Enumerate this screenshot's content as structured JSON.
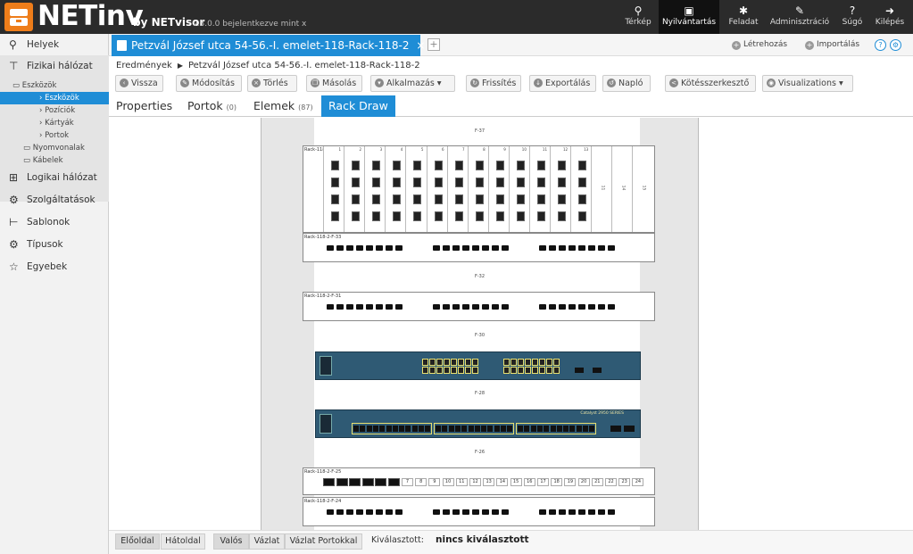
{
  "header": {
    "brand": "NETinv",
    "by": "by NETvisor",
    "version": "v.3.0.0 bejelentkezve mint x",
    "nav": [
      {
        "label": "Térkép",
        "icon": "map-pin-icon",
        "glyph": "⚲"
      },
      {
        "label": "Nyilvántartás",
        "icon": "inbox-icon",
        "glyph": "▣"
      },
      {
        "label": "Feladat",
        "icon": "gear-icon",
        "glyph": "✱"
      },
      {
        "label": "Adminisztráció",
        "icon": "wrench-icon",
        "glyph": "✎"
      },
      {
        "label": "Súgó",
        "icon": "help-icon",
        "glyph": "?"
      },
      {
        "label": "Kilépés",
        "icon": "logout-icon",
        "glyph": "➜"
      }
    ]
  },
  "sidebar": {
    "items": [
      {
        "label": "Helyek",
        "icon": "location-icon",
        "glyph": "⚲"
      },
      {
        "label": "Fizikai hálózat",
        "icon": "network-icon",
        "glyph": "⊤"
      },
      {
        "label": "Logikai hálózat",
        "icon": "logical-network-icon",
        "glyph": "⊞"
      },
      {
        "label": "Szolgáltatások",
        "icon": "services-icon",
        "glyph": "⚙"
      },
      {
        "label": "Sablonok",
        "icon": "templates-icon",
        "glyph": "⊢"
      },
      {
        "label": "Típusok",
        "icon": "types-icon",
        "glyph": "⚙"
      },
      {
        "label": "Egyebek",
        "icon": "star-icon",
        "glyph": "☆"
      }
    ],
    "tree": [
      {
        "label": "Eszközök"
      },
      {
        "label": "Eszközök",
        "selected": true
      },
      {
        "label": "Pozíciók"
      },
      {
        "label": "Kártyák"
      },
      {
        "label": "Portok"
      },
      {
        "label": "Nyomvonalak"
      },
      {
        "label": "Kábelek"
      }
    ]
  },
  "tabs": {
    "main": "Petzvál József utca 54-56.-I. emelet-118-Rack-118-2",
    "close": "×",
    "add": "+",
    "create": "Létrehozás",
    "import": "Importálás",
    "help": "?"
  },
  "breadcrumb": {
    "root": "Eredmények",
    "current": "Petzvál József utca 54-56.-I. emelet-118-Rack-118-2"
  },
  "toolbar": [
    {
      "label": "Vissza",
      "icon": "back-icon",
      "glyph": "‹"
    },
    {
      "label": "Módosítás",
      "icon": "edit-icon",
      "glyph": "✎"
    },
    {
      "label": "Törlés",
      "icon": "delete-icon",
      "glyph": "×"
    },
    {
      "label": "Másolás",
      "icon": "copy-icon",
      "glyph": "❐"
    },
    {
      "label": "Alkalmazás",
      "icon": "apply-icon",
      "glyph": "▾"
    },
    {
      "label": "Frissítés",
      "icon": "refresh-icon",
      "glyph": "↻"
    },
    {
      "label": "Exportálás",
      "icon": "export-icon",
      "glyph": "↓"
    },
    {
      "label": "Napló",
      "icon": "log-icon",
      "glyph": "↺"
    },
    {
      "label": "Kötésszerkesztő",
      "icon": "share-icon",
      "glyph": "<"
    },
    {
      "label": "Visualizations",
      "icon": "eye-icon",
      "glyph": "◉"
    }
  ],
  "subtabs": [
    {
      "label": "Properties",
      "count": ""
    },
    {
      "label": "Portok",
      "count": "(0)"
    },
    {
      "label": "Elemek",
      "count": "(87)"
    },
    {
      "label": "Rack Draw",
      "count": ""
    }
  ],
  "rack": {
    "units": [
      "F-37",
      "F-32",
      "F-30",
      "F-28",
      "F-26"
    ],
    "rack_label": "Rack-118",
    "card_numbers": [
      "1",
      "2",
      "3",
      "4",
      "5",
      "6",
      "7",
      "8",
      "9",
      "10",
      "11",
      "12",
      "13"
    ],
    "blank_labels": [
      "11",
      "14",
      "15"
    ],
    "patch_panels": [
      "Rack-118-2-F-33",
      "Rack-118-2-F-31",
      "Rack-118-2-F-25",
      "Rack-118-2-F-24"
    ],
    "switch2_brand": "Catalyst 2950 SERIES",
    "panel25_ports": [
      "7",
      "8",
      "9",
      "10",
      "11",
      "12",
      "13",
      "14",
      "15",
      "16",
      "17",
      "18",
      "19",
      "20",
      "21",
      "22",
      "23",
      "24"
    ]
  },
  "footer": {
    "front": "Előoldal",
    "back": "Hátoldal",
    "modes": [
      "Valós",
      "Vázlat",
      "Vázlat Portokkal"
    ],
    "selected_label": "Kiválasztott:",
    "selected_value": "nincs kiválasztott"
  },
  "colors": {
    "accent": "#1f8dd6",
    "brand_orange": "#ee7d1a",
    "header_bg": "#2b2b2b",
    "switch_body": "#2f5a74"
  }
}
